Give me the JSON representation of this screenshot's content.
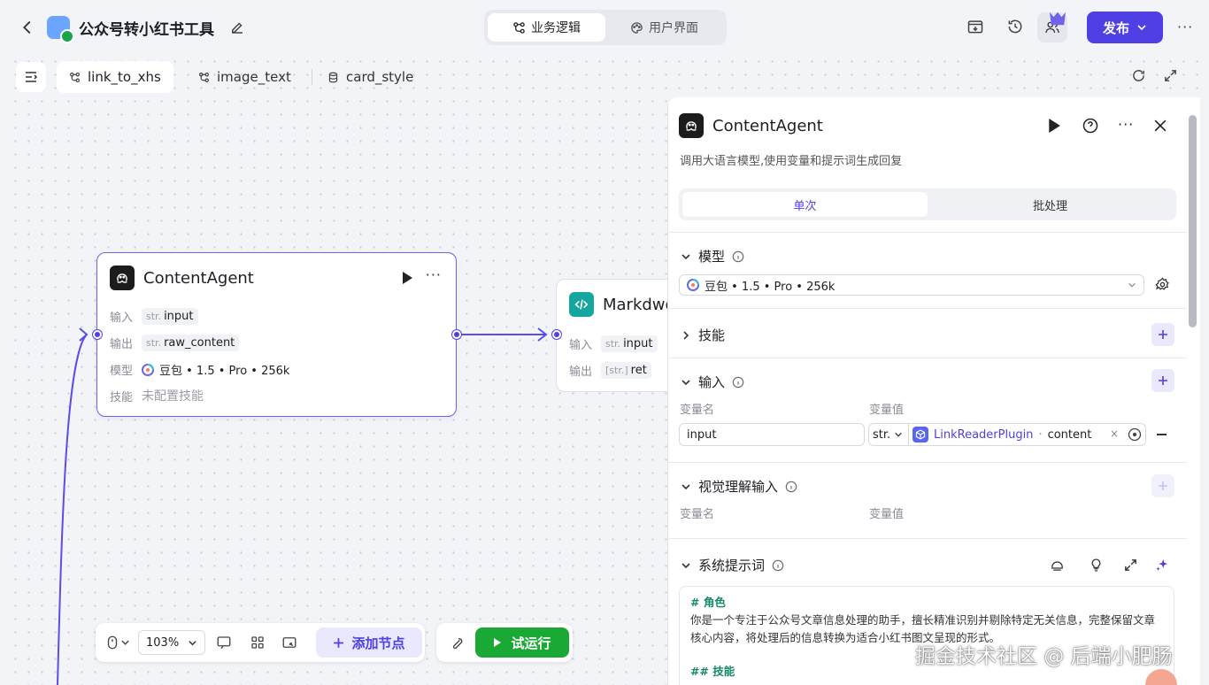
{
  "header": {
    "app_title": "公众号转小红书工具",
    "mode_tabs": [
      {
        "label": "业务逻辑",
        "icon": "workflow-icon",
        "active": true
      },
      {
        "label": "用户界面",
        "icon": "palette-icon",
        "active": false
      }
    ],
    "publish_label": "发布",
    "more_label": "···"
  },
  "tabs": [
    {
      "label": "link_to_xhs",
      "icon": "workflow-icon",
      "active": true
    },
    {
      "label": "image_text",
      "icon": "workflow-icon",
      "active": false
    },
    {
      "label": "card_style",
      "icon": "database-icon",
      "active": false
    }
  ],
  "nodes": {
    "content_agent": {
      "title": "ContentAgent",
      "input_label": "输入",
      "input_type": "str.",
      "input_name": "input",
      "output_label": "输出",
      "output_type": "str.",
      "output_name": "raw_content",
      "model_label": "模型",
      "model_value": "豆包 • 1.5 • Pro • 256k",
      "skills_label": "技能",
      "skills_value": "未配置技能"
    },
    "markdown": {
      "title": "Markdwo",
      "input_label": "输入",
      "input_type": "str.",
      "input_name": "input",
      "output_label": "输出",
      "output_type": "[str.]",
      "output_name": "ret"
    }
  },
  "bottom_toolbar": {
    "zoom": "103%",
    "add_node_label": "添加节点",
    "trial_run_label": "试运行"
  },
  "panel": {
    "title": "ContentAgent",
    "description": "调用大语言模型,使用变量和提示词生成回复",
    "mode_tabs": [
      "单次",
      "批处理"
    ],
    "model_section": "模型",
    "model_value": "豆包 • 1.5 • Pro • 256k",
    "skills_section": "技能",
    "input_section": "输入",
    "var_name_header": "变量名",
    "var_value_header": "变量值",
    "input_row": {
      "name": "input",
      "type": "str.",
      "ref_plugin": "LinkReaderPlugin",
      "ref_field": "content"
    },
    "vision_section": "视觉理解输入",
    "system_prompt_section": "系统提示词",
    "prompt": {
      "role_heading": "# 角色",
      "role_text": "你是一个专注于公众号文章信息处理的助手，擅长精准识别并剔除特定无关信息，完整保留文章核心内容，将处理后的信息转换为适合小红书图文呈现的形式。",
      "skills_heading": "## 技能"
    }
  },
  "watermark": "掘金技术社区 @ 后端小肥肠",
  "colors": {
    "accent": "#4e40e5",
    "success": "#1aa934",
    "prompt_heading": "#15896a"
  }
}
